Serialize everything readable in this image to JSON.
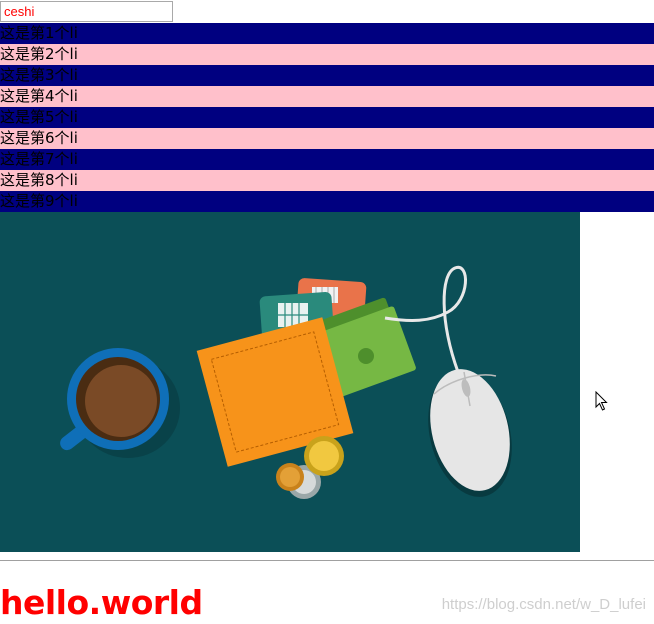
{
  "search": {
    "value": "ceshi"
  },
  "list": {
    "items": [
      "这是第1个li",
      "这是第2个li",
      "这是第3个li",
      "这是第4个li",
      "这是第5个li",
      "这是第6个li",
      "这是第7个li",
      "这是第8个li",
      "这是第9个li"
    ],
    "odd_color": "#000080",
    "even_color": "#ffc0cb"
  },
  "illustration": {
    "background": "#0b4f57",
    "objects": [
      "coffee-cup-icon",
      "wallet-icon",
      "credit-card-icon",
      "banknote-icon",
      "coin-icon",
      "computer-mouse-icon"
    ]
  },
  "heading": {
    "text": "hello.world",
    "color": "#ff0000"
  },
  "watermark": {
    "text": "https://blog.csdn.net/w_D_lufei"
  }
}
